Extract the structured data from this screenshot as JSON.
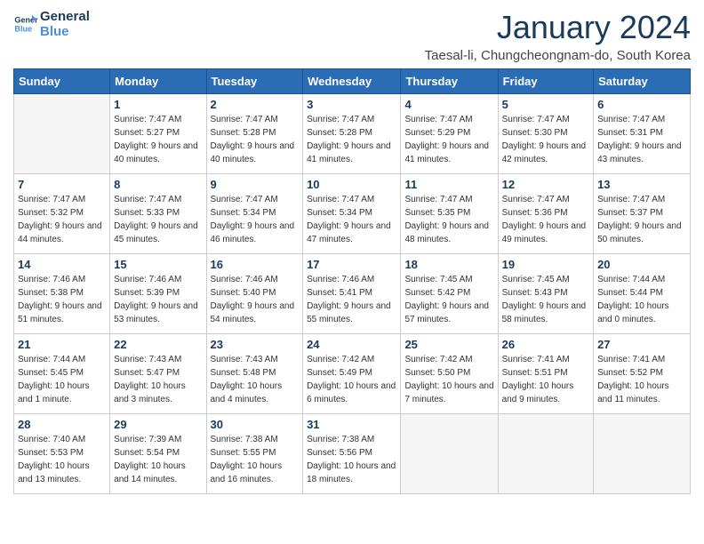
{
  "header": {
    "logo_line1": "General",
    "logo_line2": "Blue",
    "month_title": "January 2024",
    "location": "Taesal-li, Chungcheongnam-do, South Korea"
  },
  "weekdays": [
    "Sunday",
    "Monday",
    "Tuesday",
    "Wednesday",
    "Thursday",
    "Friday",
    "Saturday"
  ],
  "weeks": [
    [
      {
        "day": "",
        "empty": true
      },
      {
        "day": "1",
        "sunrise": "7:47 AM",
        "sunset": "5:27 PM",
        "daylight": "9 hours and 40 minutes."
      },
      {
        "day": "2",
        "sunrise": "7:47 AM",
        "sunset": "5:28 PM",
        "daylight": "9 hours and 40 minutes."
      },
      {
        "day": "3",
        "sunrise": "7:47 AM",
        "sunset": "5:28 PM",
        "daylight": "9 hours and 41 minutes."
      },
      {
        "day": "4",
        "sunrise": "7:47 AM",
        "sunset": "5:29 PM",
        "daylight": "9 hours and 41 minutes."
      },
      {
        "day": "5",
        "sunrise": "7:47 AM",
        "sunset": "5:30 PM",
        "daylight": "9 hours and 42 minutes."
      },
      {
        "day": "6",
        "sunrise": "7:47 AM",
        "sunset": "5:31 PM",
        "daylight": "9 hours and 43 minutes."
      }
    ],
    [
      {
        "day": "7",
        "sunrise": "7:47 AM",
        "sunset": "5:32 PM",
        "daylight": "9 hours and 44 minutes."
      },
      {
        "day": "8",
        "sunrise": "7:47 AM",
        "sunset": "5:33 PM",
        "daylight": "9 hours and 45 minutes."
      },
      {
        "day": "9",
        "sunrise": "7:47 AM",
        "sunset": "5:34 PM",
        "daylight": "9 hours and 46 minutes."
      },
      {
        "day": "10",
        "sunrise": "7:47 AM",
        "sunset": "5:34 PM",
        "daylight": "9 hours and 47 minutes."
      },
      {
        "day": "11",
        "sunrise": "7:47 AM",
        "sunset": "5:35 PM",
        "daylight": "9 hours and 48 minutes."
      },
      {
        "day": "12",
        "sunrise": "7:47 AM",
        "sunset": "5:36 PM",
        "daylight": "9 hours and 49 minutes."
      },
      {
        "day": "13",
        "sunrise": "7:47 AM",
        "sunset": "5:37 PM",
        "daylight": "9 hours and 50 minutes."
      }
    ],
    [
      {
        "day": "14",
        "sunrise": "7:46 AM",
        "sunset": "5:38 PM",
        "daylight": "9 hours and 51 minutes."
      },
      {
        "day": "15",
        "sunrise": "7:46 AM",
        "sunset": "5:39 PM",
        "daylight": "9 hours and 53 minutes."
      },
      {
        "day": "16",
        "sunrise": "7:46 AM",
        "sunset": "5:40 PM",
        "daylight": "9 hours and 54 minutes."
      },
      {
        "day": "17",
        "sunrise": "7:46 AM",
        "sunset": "5:41 PM",
        "daylight": "9 hours and 55 minutes."
      },
      {
        "day": "18",
        "sunrise": "7:45 AM",
        "sunset": "5:42 PM",
        "daylight": "9 hours and 57 minutes."
      },
      {
        "day": "19",
        "sunrise": "7:45 AM",
        "sunset": "5:43 PM",
        "daylight": "9 hours and 58 minutes."
      },
      {
        "day": "20",
        "sunrise": "7:44 AM",
        "sunset": "5:44 PM",
        "daylight": "10 hours and 0 minutes."
      }
    ],
    [
      {
        "day": "21",
        "sunrise": "7:44 AM",
        "sunset": "5:45 PM",
        "daylight": "10 hours and 1 minute."
      },
      {
        "day": "22",
        "sunrise": "7:43 AM",
        "sunset": "5:47 PM",
        "daylight": "10 hours and 3 minutes."
      },
      {
        "day": "23",
        "sunrise": "7:43 AM",
        "sunset": "5:48 PM",
        "daylight": "10 hours and 4 minutes."
      },
      {
        "day": "24",
        "sunrise": "7:42 AM",
        "sunset": "5:49 PM",
        "daylight": "10 hours and 6 minutes."
      },
      {
        "day": "25",
        "sunrise": "7:42 AM",
        "sunset": "5:50 PM",
        "daylight": "10 hours and 7 minutes."
      },
      {
        "day": "26",
        "sunrise": "7:41 AM",
        "sunset": "5:51 PM",
        "daylight": "10 hours and 9 minutes."
      },
      {
        "day": "27",
        "sunrise": "7:41 AM",
        "sunset": "5:52 PM",
        "daylight": "10 hours and 11 minutes."
      }
    ],
    [
      {
        "day": "28",
        "sunrise": "7:40 AM",
        "sunset": "5:53 PM",
        "daylight": "10 hours and 13 minutes."
      },
      {
        "day": "29",
        "sunrise": "7:39 AM",
        "sunset": "5:54 PM",
        "daylight": "10 hours and 14 minutes."
      },
      {
        "day": "30",
        "sunrise": "7:38 AM",
        "sunset": "5:55 PM",
        "daylight": "10 hours and 16 minutes."
      },
      {
        "day": "31",
        "sunrise": "7:38 AM",
        "sunset": "5:56 PM",
        "daylight": "10 hours and 18 minutes."
      },
      {
        "day": "",
        "empty": true
      },
      {
        "day": "",
        "empty": true
      },
      {
        "day": "",
        "empty": true
      }
    ]
  ]
}
